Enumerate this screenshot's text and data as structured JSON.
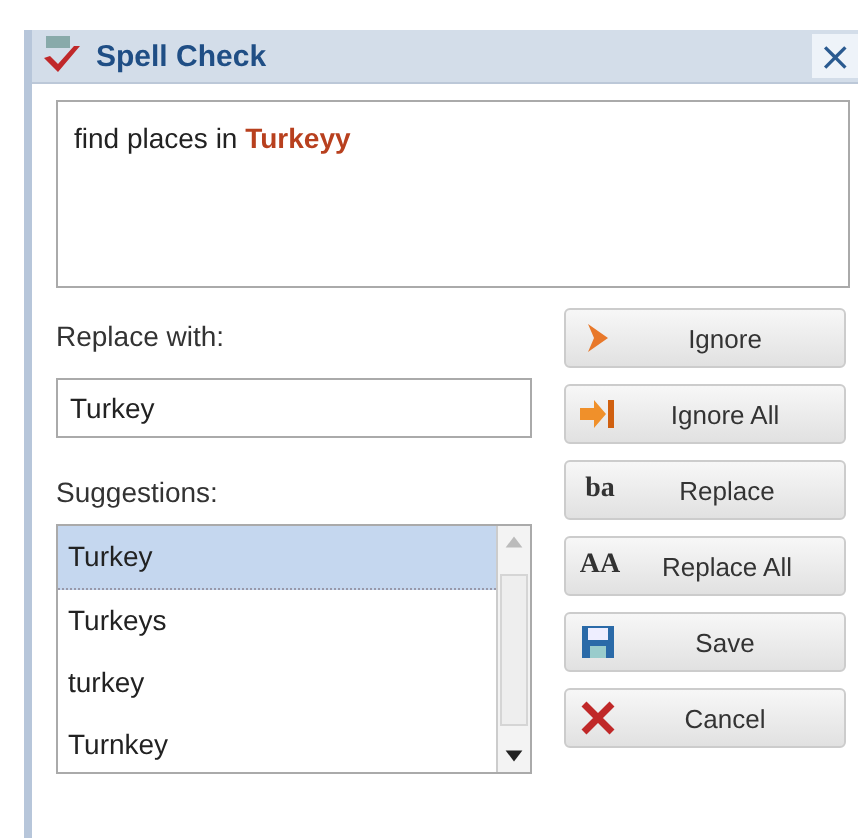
{
  "window": {
    "title": "Spell Check",
    "close": "×"
  },
  "text": "find places in **Turkeyy**",
  "replace_label": "Replace with:",
  "replace_value": "Turkey",
  "suggestions_label": "Suggestions:",
  "suggestions": [
    {
      "label": "Turkey",
      "selected": true
    },
    {
      "label": "Turkeys",
      "selected": false
    },
    {
      "label": "turkey",
      "selected": false
    },
    {
      "label": "Turnkey",
      "selected": false
    }
  ],
  "buttons": [
    {
      "label": "Ignore",
      "kind": "ignore"
    },
    {
      "label": "Ignore All",
      "kind": "ignore_all"
    },
    {
      "label": "Replace",
      "kind": "replace",
      "glyph": "ba"
    },
    {
      "label": "Replace All",
      "kind": "replace_all",
      "glyph": "AA"
    },
    {
      "label": "Save",
      "kind": "save"
    },
    {
      "label": "Cancel",
      "kind": "cancel"
    }
  ]
}
